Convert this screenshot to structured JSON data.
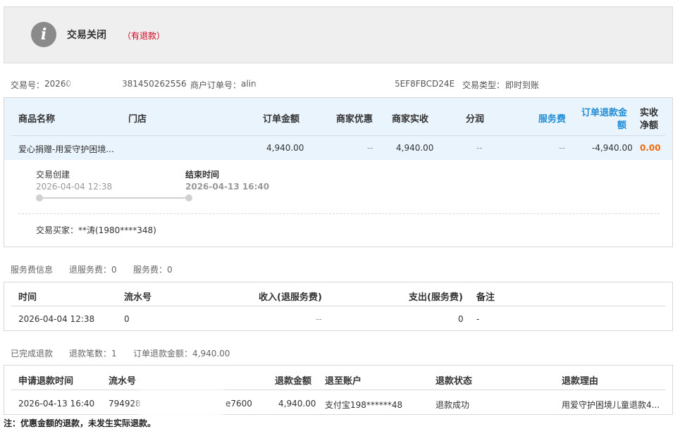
{
  "status": {
    "title": "交易关闭",
    "subtitle": "（有退款）"
  },
  "trade_info": {
    "trade_no_label": "交易号：",
    "trade_no_start": "20260",
    "trade_no_end": "381450262556",
    "merchant_order_label": "商户订单号：",
    "merchant_order_start": "alin",
    "merchant_order_end": "5EF8FBCD24E",
    "trade_type_label": "交易类型：",
    "trade_type_value": "即时到账"
  },
  "order_table": {
    "headers": {
      "product": "商品名称",
      "store": "门店",
      "amount": "订单金额",
      "discount": "商家优惠",
      "received": "商家实收",
      "split": "分润",
      "service_fee": "服务费",
      "refund_line1": "订单退款金",
      "refund_line2": "额",
      "net_line1": "实收",
      "net_line2": "净额"
    },
    "row": {
      "product": "爱心捐赠-用爱守护困境...",
      "amount": "4,940.00",
      "discount": "--",
      "received": "4,940.00",
      "split": "--",
      "service_fee": "--",
      "refund": "-4,940.00",
      "net": "0.00"
    }
  },
  "timeline": {
    "created_label": "交易创建",
    "created_time": "2026-04-04 12:38",
    "ended_label": "结束时间",
    "ended_time": "2026-04-13 16:40"
  },
  "buyer": "交易买家：**涛(1980****348)",
  "service_section": {
    "title": "服务费信息",
    "refund_fee_label": "退服务费：0",
    "fee_label": "服务费：0",
    "headers": [
      "时间",
      "流水号",
      "收入(退服务费)",
      "支出(服务费)",
      "备注"
    ],
    "row": [
      "2026-04-04 12:38",
      "0",
      "--",
      "0",
      "-"
    ]
  },
  "refund_section": {
    "title": "已完成退款",
    "count_label": "退款笔数：1",
    "amount_label": "订单退款金额：4,940.00",
    "headers": [
      "申请退款时间",
      "流水号",
      "退款金额",
      "退至账户",
      "退款状态",
      "退款理由"
    ],
    "row": {
      "time": "2026-04-13 16:40",
      "serial_start": "794928",
      "serial_end": "e7600",
      "amount": "4,940.00",
      "account": "支付宝198******48",
      "status": "退款成功",
      "reason": "用爱守护困境儿童退款4..."
    }
  },
  "note": "注：优惠金额的退款，未发生实际退款。"
}
